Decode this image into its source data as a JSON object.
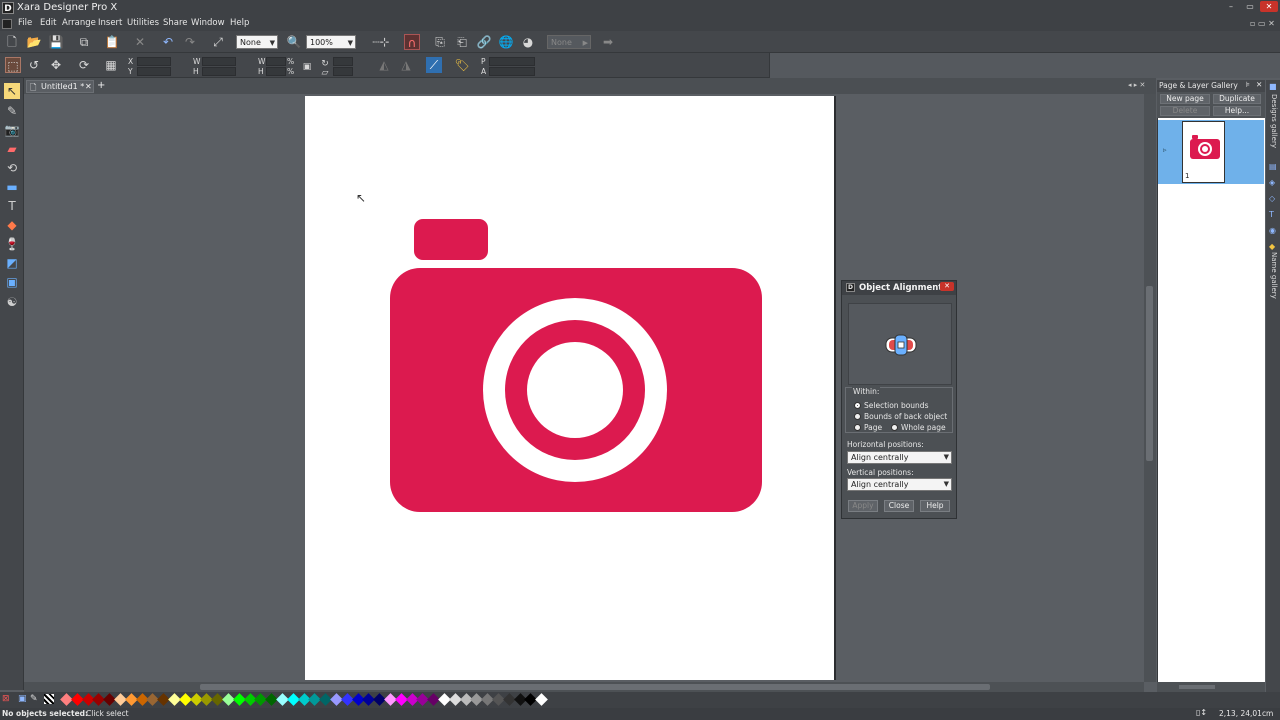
{
  "window": {
    "title": "Xara Designer Pro X",
    "app_icon_letter": "D",
    "buttons": [
      "–",
      "▭",
      "✕"
    ]
  },
  "menu": [
    "File",
    "Edit",
    "Arrange",
    "Insert",
    "Utilities",
    "Share",
    "Window",
    "Help"
  ],
  "toolbar": {
    "quality_value": "None",
    "zoom_value": "100%",
    "nav_value": "None"
  },
  "infobar": {
    "x_label": "X",
    "y_label": "Y",
    "w_label": "W",
    "h_label": "H",
    "w2_label": "W",
    "h2_label": "H",
    "pct1": "%",
    "pct2": "%",
    "p_label": "P",
    "a_label": "A"
  },
  "document": {
    "tab_label": "Untitled1 *",
    "camera_color": "#dc1a4f"
  },
  "gallery": {
    "title": "Page & Layer Gallery",
    "buttons": [
      "New page",
      "Duplicate",
      "Delete",
      "Help..."
    ],
    "page_number": "1",
    "side_tabs": [
      "Designs gallery",
      "Name gallery"
    ]
  },
  "dialog": {
    "title": "Object Alignment",
    "within_label": "Within:",
    "options": {
      "selection_bounds": "Selection bounds",
      "back_object": "Bounds of back object",
      "page": "Page",
      "whole_page": "Whole page"
    },
    "horizontal_label": "Horizontal positions:",
    "horizontal_value": "Align centrally",
    "vertical_label": "Vertical positions:",
    "vertical_value": "Align centrally",
    "apply_label": "Apply",
    "close_label": "Close",
    "help_label": "Help"
  },
  "status": {
    "text_bold": "No objects selected:",
    "text": "Click select",
    "coords": "2,13, 24,01cm"
  },
  "palette_colors": [
    "#ff8080",
    "#ff0000",
    "#cc0000",
    "#990000",
    "#660000",
    "#ffcc99",
    "#ff9933",
    "#cc6600",
    "#996633",
    "#663300",
    "#ffff99",
    "#ffff00",
    "#cccc00",
    "#999900",
    "#666600",
    "#99ff99",
    "#00ff00",
    "#00cc00",
    "#009900",
    "#006600",
    "#99ffff",
    "#00ffff",
    "#00cccc",
    "#009999",
    "#006666",
    "#9999ff",
    "#3333ff",
    "#0000cc",
    "#000099",
    "#000066",
    "#ff99ff",
    "#ff00ff",
    "#cc00cc",
    "#990099",
    "#660066",
    "#ffffff",
    "#dddddd",
    "#bbbbbb",
    "#999999",
    "#777777",
    "#555555",
    "#333333",
    "#111111",
    "#000000",
    "#ffffff"
  ]
}
